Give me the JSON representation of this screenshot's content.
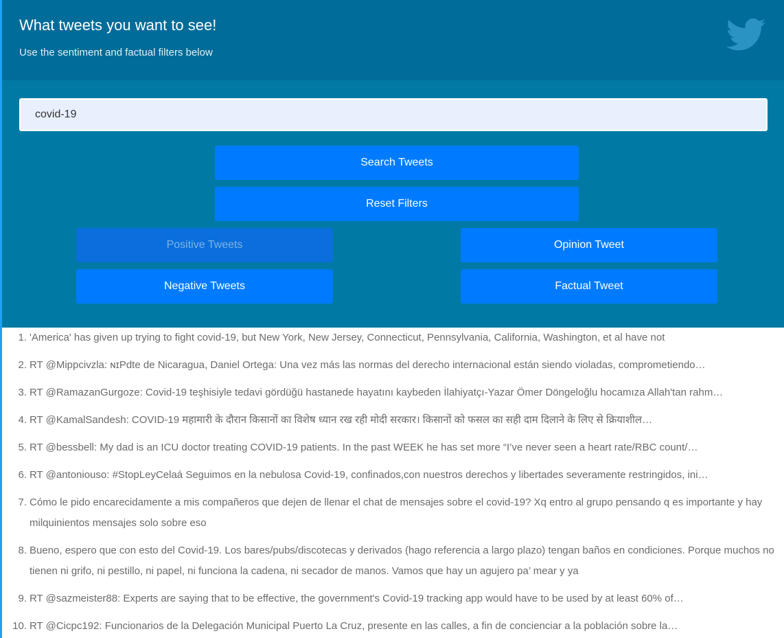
{
  "header": {
    "title": "What tweets you want to see!",
    "subtitle": "Use the sentiment and factual filters below",
    "logo_icon": "twitter-bird-icon"
  },
  "search": {
    "value": "covid-19"
  },
  "buttons": {
    "search": "Search Tweets",
    "reset": "Reset Filters",
    "positive": "Positive Tweets",
    "opinion": "Opinion Tweet",
    "negative": "Negative Tweets",
    "factual": "Factual Tweet"
  },
  "colors": {
    "header_bg": "#006c99",
    "panel_bg": "#007aa5",
    "button": "#007bff",
    "accent_border": "#1da1f2"
  },
  "tweets": [
    {
      "num": "1.",
      "text": "'America' has given up trying to fight covid-19, but New York, New Jersey, Connecticut, Pennsylvania, California, Washington, et al have not"
    },
    {
      "num": "2.",
      "text": "RT @Mippcivzla: ɴɪPdte de Nicaragua, Daniel Ortega: Una vez más las normas del derecho internacional están siendo violadas, comprometiendo…"
    },
    {
      "num": "3.",
      "text": "RT @RamazanGurgoze: Covid-19 teşhisiyle tedavi gördüğü hastanede hayatını kaybeden İlahiyatçı-Yazar Ömer Döngeloğlu hocamıza Allah'tan rahm…"
    },
    {
      "num": "4.",
      "text": "RT @KamalSandesh: COVID-19 महामारी के दौरान किसानों का विशेष ध्यान रख रही मोदी सरकार। किसानों को फसल का सही दाम दिलाने के लिए से क्रियाशील…"
    },
    {
      "num": "5.",
      "text": "RT @bessbell: My dad is an ICU doctor treating COVID-19 patients. In the past WEEK he has set more “I’ve never seen a heart rate/RBC count/…"
    },
    {
      "num": "6.",
      "text": "RT @antoniouso: #StopLeyCelaá Seguimos en la nebulosa Covid-19, confinados,con nuestros derechos y libertades severamente restringidos, ini…"
    },
    {
      "num": "7.",
      "text": "Cómo le pido encarecidamente a mis compañeros que dejen de llenar el chat de mensajes sobre el covid-19? Xq entro al grupo pensando q es importante y hay milquinientos mensajes solo sobre eso"
    },
    {
      "num": "8.",
      "text": "Bueno, espero que con esto del Covid-19. Los bares/pubs/discotecas y derivados (hago referencia a largo plazo) tengan baños en condiciones. Porque muchos no tienen ni grifo, ni pestillo, ni papel, ni funciona la cadena, ni secador de manos. Vamos que hay un agujero pa’ mear y ya"
    },
    {
      "num": "9.",
      "text": "RT @sazmeister88: Experts are saying that to be effective, the government's Covid-19 tracking app would have to be used by at least 60% of…"
    },
    {
      "num": "10.",
      "text": "RT @Cicpc192: Funcionarios de la Delegación Municipal Puerto La Cruz, presente en las calles, a fin de concienciar a la población sobre la…"
    }
  ]
}
